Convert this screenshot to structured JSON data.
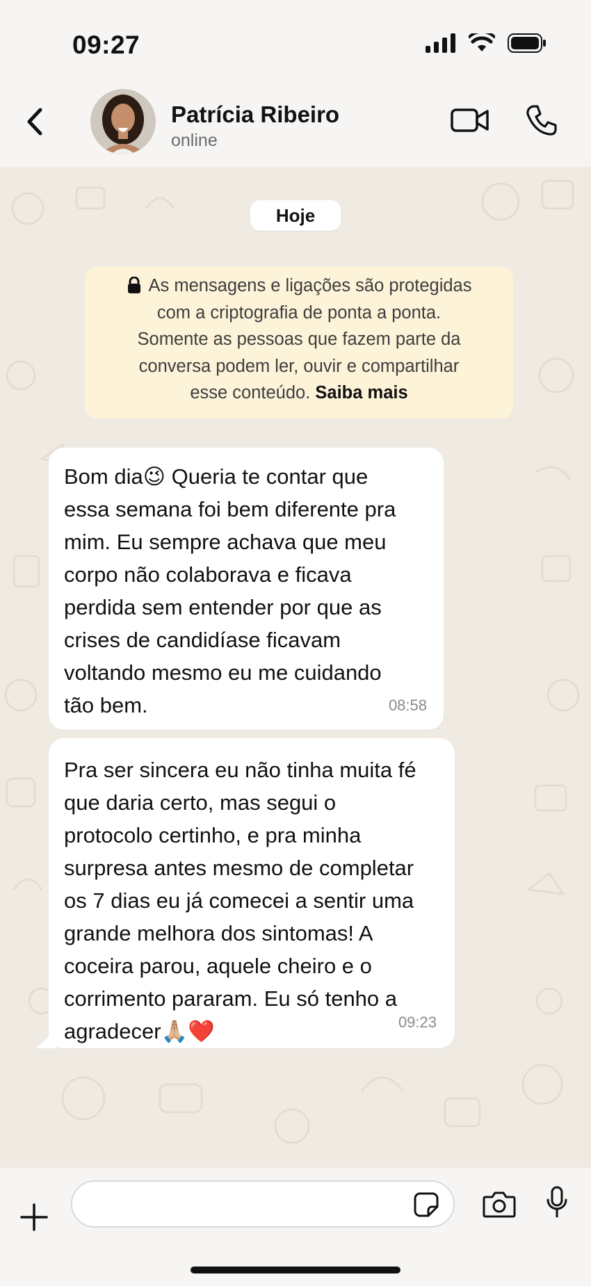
{
  "status_bar": {
    "time": "09:27",
    "icons": [
      "signal-icon",
      "wifi-icon",
      "battery-icon"
    ]
  },
  "header": {
    "contact_name": "Patrícia Ribeiro",
    "contact_status": "online",
    "icons": [
      "back-chevron-icon",
      "video-call-icon",
      "phone-icon"
    ]
  },
  "chat": {
    "date_label": "Hoje",
    "encryption_notice": {
      "lines": [
        "As mensagens e ligações são protegidas",
        "com a criptografia de ponta a ponta.",
        "Somente as pessoas que fazem parte da",
        "conversa podem ler, ouvir e compartilhar",
        "esse conteúdo."
      ],
      "link": "Saiba mais"
    },
    "messages": [
      {
        "lines": [
          "Bom dia😉 Queria te contar que",
          "essa semana foi bem diferente pra",
          "mim. Eu sempre achava que meu",
          "corpo não colaborava e ficava",
          "perdida sem entender por que as",
          "crises de candidíase ficavam",
          "voltando mesmo eu me cuidando",
          "tão bem."
        ],
        "time": "08:58"
      },
      {
        "lines": [
          "Pra ser sincera eu não tinha muita fé",
          "que daria certo, mas segui o",
          "protocolo certinho, e pra minha",
          "surpresa antes mesmo de completar",
          "os 7 dias eu já comecei a sentir uma",
          "grande melhora dos sintomas! A",
          "coceira parou, aquele cheiro e o",
          "corrimento pararam. Eu só tenho a",
          "agradecer🙏🏼❤️"
        ],
        "time": "09:23"
      }
    ]
  },
  "composer": {
    "input_value": "",
    "icons": [
      "plus-icon",
      "sticker-icon",
      "camera-icon",
      "microphone-icon"
    ]
  },
  "colors": {
    "chat_background": "#efeae2",
    "header_background": "#f6f5f3",
    "bubble_incoming": "#ffffff",
    "encryption_notice_bg": "#fdf3d9"
  }
}
